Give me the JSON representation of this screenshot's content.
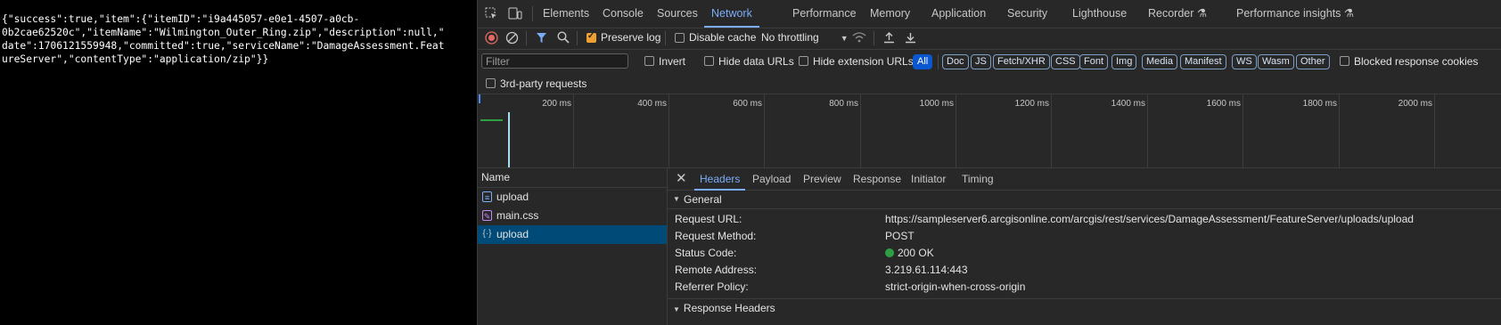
{
  "response_body": {
    "lines": [
      "{\"success\":true,\"item\":{\"itemID\":\"i9a445057-e0e1-4507-a0cb-",
      "0b2cae62520c\",\"itemName\":\"Wilmington_Outer_Ring.zip\",\"description\":null,\"",
      "date\":1706121559948,\"committed\":true,\"serviceName\":\"DamageAssessment.Feat",
      "ureServer\",\"contentType\":\"application/zip\"}}"
    ]
  },
  "tabs": {
    "elements": "Elements",
    "console": "Console",
    "sources": "Sources",
    "network": "Network",
    "performance": "Performance",
    "memory": "Memory",
    "application": "Application",
    "security": "Security",
    "lighthouse": "Lighthouse",
    "recorder": "Recorder",
    "performance_insights": "Performance insights"
  },
  "toolbar": {
    "preserve_log": "Preserve log",
    "preserve_log_checked": true,
    "disable_cache": "Disable cache",
    "throttling": "No throttling"
  },
  "filter": {
    "placeholder": "Filter",
    "invert": "Invert",
    "hide_data_urls": "Hide data URLs",
    "hide_extension_urls": "Hide extension URLs",
    "types": [
      "All",
      "Doc",
      "JS",
      "Fetch/XHR",
      "CSS",
      "Font",
      "Img",
      "Media",
      "Manifest",
      "WS",
      "Wasm",
      "Other"
    ],
    "blocked_cookies": "Blocked response cookies",
    "third_party": "3rd-party requests"
  },
  "timeline": {
    "ticks": [
      "200 ms",
      "400 ms",
      "600 ms",
      "800 ms",
      "1000 ms",
      "1200 ms",
      "1400 ms",
      "1600 ms",
      "1800 ms",
      "2000 ms"
    ]
  },
  "requests": {
    "header": "Name",
    "items": [
      {
        "name": "upload",
        "type": "document"
      },
      {
        "name": "main.css",
        "type": "stylesheet"
      },
      {
        "name": "upload",
        "type": "fetch"
      }
    ]
  },
  "details": {
    "tabs": [
      "Headers",
      "Payload",
      "Preview",
      "Response",
      "Initiator",
      "Timing"
    ],
    "general_label": "General",
    "rows": [
      {
        "key": "Request URL:",
        "value": "https://sampleserver6.arcgisonline.com/arcgis/rest/services/DamageAssessment/FeatureServer/uploads/upload"
      },
      {
        "key": "Request Method:",
        "value": "POST"
      },
      {
        "key": "Status Code:",
        "value": "200 OK"
      },
      {
        "key": "Remote Address:",
        "value": "3.219.61.114:443"
      },
      {
        "key": "Referrer Policy:",
        "value": "strict-origin-when-cross-origin"
      }
    ],
    "status_color": "#2ea043",
    "next_section_label": "Response Headers"
  },
  "colors": {
    "accent": "#7cacf8",
    "selected_row": "#004a77",
    "record_red": "#e46962",
    "checkbox_orange": "#f0a030"
  }
}
